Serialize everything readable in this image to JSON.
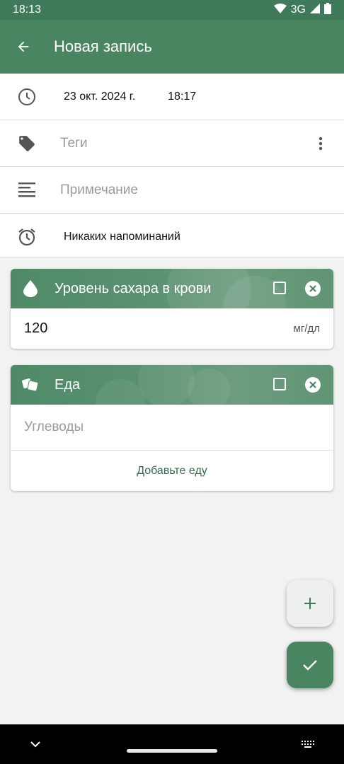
{
  "status_bar": {
    "time": "18:13",
    "network": "3G"
  },
  "app_bar": {
    "title": "Новая запись"
  },
  "form": {
    "date": "23 окт. 2024 г.",
    "time": "18:17",
    "tags_placeholder": "Теги",
    "note_placeholder": "Примечание",
    "reminder": "Никаких напоминаний"
  },
  "cards": {
    "blood_sugar": {
      "title": "Уровень сахара в крови",
      "value": "120",
      "unit": "мг/дл"
    },
    "food": {
      "title": "Еда",
      "carbs_placeholder": "Углеводы",
      "add_food_label": "Добавьте еду"
    }
  },
  "colors": {
    "primary": "#4a8562",
    "accent_text": "#2f6e4a",
    "status_bar": "#3f7a5a"
  }
}
